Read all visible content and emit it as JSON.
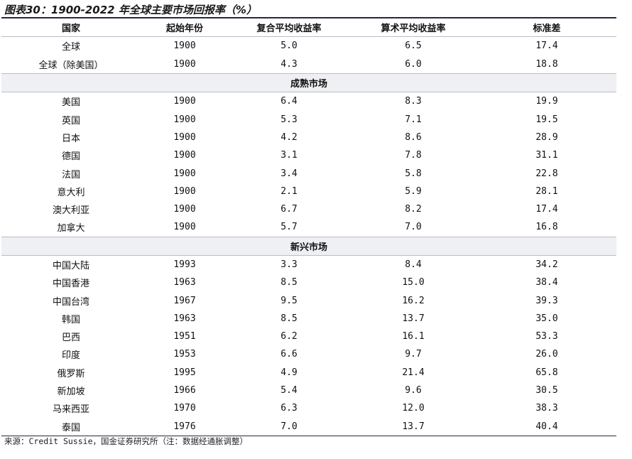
{
  "title": "图表30：1900-2022 年全球主要市场回报率（%）",
  "columns": [
    "国家",
    "起始年份",
    "复合平均收益率",
    "算术平均收益率",
    "标准差"
  ],
  "global_rows": [
    [
      "全球",
      "1900",
      "5.0",
      "6.5",
      "17.4"
    ],
    [
      "全球（除美国）",
      "1900",
      "4.3",
      "6.0",
      "18.8"
    ]
  ],
  "developed_label": "成熟市场",
  "developed_rows": [
    [
      "美国",
      "1900",
      "6.4",
      "8.3",
      "19.9"
    ],
    [
      "英国",
      "1900",
      "5.3",
      "7.1",
      "19.5"
    ],
    [
      "日本",
      "1900",
      "4.2",
      "8.6",
      "28.9"
    ],
    [
      "德国",
      "1900",
      "3.1",
      "7.8",
      "31.1"
    ],
    [
      "法国",
      "1900",
      "3.4",
      "5.8",
      "22.8"
    ],
    [
      "意大利",
      "1900",
      "2.1",
      "5.9",
      "28.1"
    ],
    [
      "澳大利亚",
      "1900",
      "6.7",
      "8.2",
      "17.4"
    ],
    [
      "加拿大",
      "1900",
      "5.7",
      "7.0",
      "16.8"
    ]
  ],
  "emerging_label": "新兴市场",
  "emerging_rows": [
    [
      "中国大陆",
      "1993",
      "3.3",
      "8.4",
      "34.2"
    ],
    [
      "中国香港",
      "1963",
      "8.5",
      "15.0",
      "38.4"
    ],
    [
      "中国台湾",
      "1967",
      "9.5",
      "16.2",
      "39.3"
    ],
    [
      "韩国",
      "1963",
      "8.5",
      "13.7",
      "35.0"
    ],
    [
      "巴西",
      "1951",
      "6.2",
      "16.1",
      "53.3"
    ],
    [
      "印度",
      "1953",
      "6.6",
      "9.7",
      "26.0"
    ],
    [
      "俄罗斯",
      "1995",
      "4.9",
      "21.4",
      "65.8"
    ],
    [
      "新加坡",
      "1966",
      "5.4",
      "9.6",
      "30.5"
    ],
    [
      "马来西亚",
      "1970",
      "6.3",
      "12.0",
      "38.3"
    ],
    [
      "泰国",
      "1976",
      "7.0",
      "13.7",
      "40.4"
    ]
  ],
  "source": "来源：Credit Sussie，国金证券研究所（注：数据经通胀调整）"
}
